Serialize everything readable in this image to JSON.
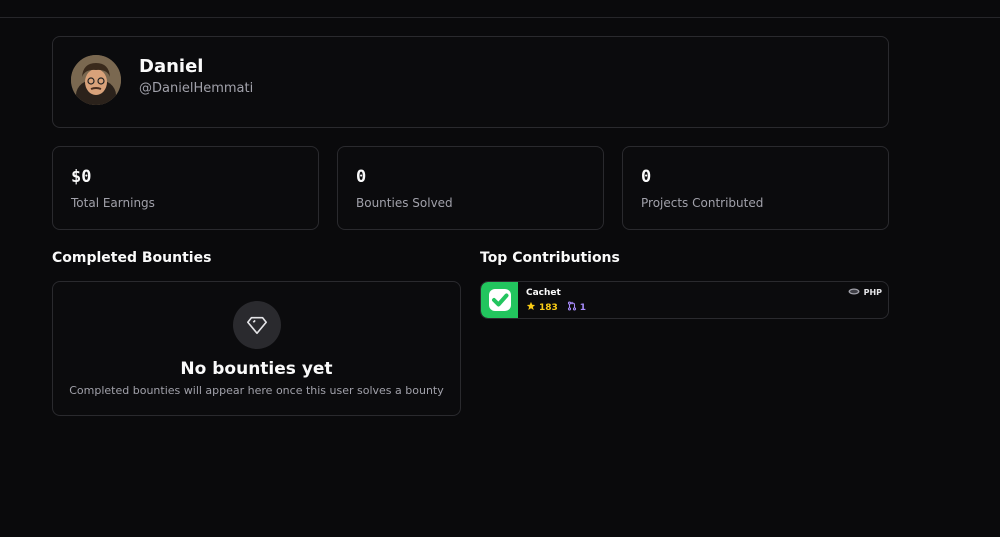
{
  "profile": {
    "name": "Daniel",
    "handle": "@DanielHemmati"
  },
  "stats": [
    {
      "value": "$0",
      "label": "Total Earnings"
    },
    {
      "value": "0",
      "label": "Bounties Solved"
    },
    {
      "value": "0",
      "label": "Projects Contributed"
    }
  ],
  "completed": {
    "title": "Completed Bounties",
    "empty_icon": "diamond-icon",
    "empty_title": "No bounties yet",
    "empty_subtitle": "Completed bounties will appear here once this user solves a bounty"
  },
  "contributions": {
    "title": "Top Contributions",
    "items": [
      {
        "repo": "Cachet",
        "stars": "183",
        "pull_requests": "1",
        "language": "PHP",
        "logo_color": "#22c55e"
      }
    ]
  },
  "colors": {
    "background": "#0a0a0c",
    "border": "#2a2a2e",
    "star": "#facc15",
    "pr": "#a78bfa"
  }
}
